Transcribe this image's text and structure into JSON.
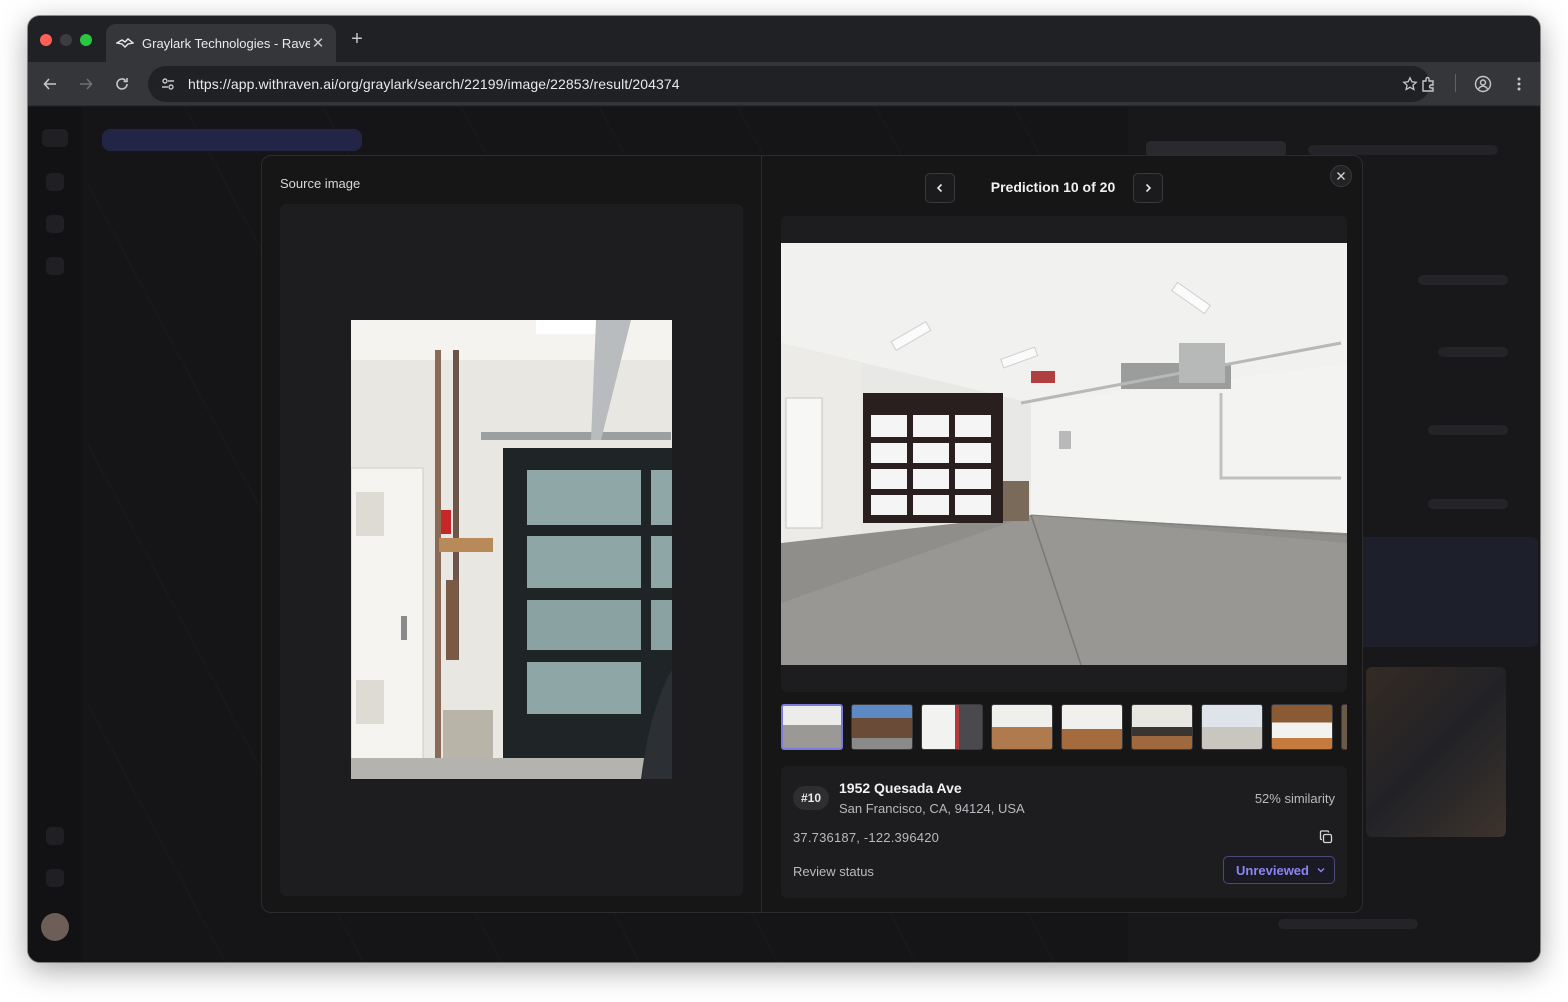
{
  "browser": {
    "tab_title": "Graylark Technologies - Rave",
    "url": "https://app.withraven.ai/org/graylark/search/22199/image/22853/result/204374",
    "icons": [
      "back-icon",
      "forward-icon",
      "reload-icon",
      "tune-icon",
      "star-icon",
      "extensions-icon",
      "profile-icon",
      "more-icon"
    ]
  },
  "modal": {
    "source_label": "Source image",
    "prediction_label": "Prediction 10 of 20",
    "thumbnails_count_visible": 8,
    "result": {
      "rank": "#10",
      "address": "1952 Quesada Ave",
      "city_line": "San Francisco, CA, 94124, USA",
      "similarity": "52% similarity",
      "coordinates": "37.736187, -122.396420",
      "review_label": "Review status",
      "review_value": "Unreviewed"
    }
  },
  "colors": {
    "accent": "#8b85f2",
    "modal_bg": "#161616",
    "page_bg": "#151517"
  }
}
